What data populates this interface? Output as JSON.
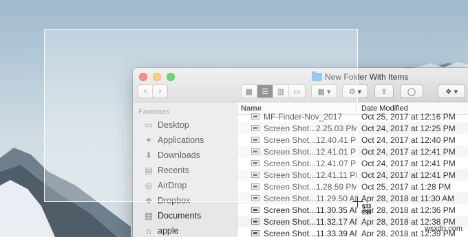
{
  "window": {
    "title": "New Folder With Items"
  },
  "toolbar": {
    "back_icon": "chevron-left-icon",
    "forward_icon": "chevron-right-icon",
    "views": [
      "icon-view-icon",
      "list-view-icon",
      "column-view-icon",
      "gallery-view-icon"
    ],
    "active_view": "list-view-icon"
  },
  "sidebar": {
    "heading": "Favorites",
    "items": [
      {
        "label": "Desktop",
        "icon": "desktop-icon"
      },
      {
        "label": "Applications",
        "icon": "applications-icon"
      },
      {
        "label": "Downloads",
        "icon": "downloads-icon"
      },
      {
        "label": "Recents",
        "icon": "recents-icon"
      },
      {
        "label": "AirDrop",
        "icon": "airdrop-icon"
      },
      {
        "label": "Dropbox",
        "icon": "dropbox-icon"
      },
      {
        "label": "Documents",
        "icon": "documents-icon"
      },
      {
        "label": "apple",
        "icon": "home-icon"
      }
    ]
  },
  "list": {
    "col_name": "Name",
    "col_date": "Date Modified",
    "rows": [
      {
        "name": "MF-Finder-Nov_2017",
        "date": "Oct 25, 2017 at 12:16 PM"
      },
      {
        "name": "Screen Shot...2.25.03 PM",
        "date": "Oct 24, 2017 at 12:25 PM"
      },
      {
        "name": "Screen Shot...12.40.41 PM",
        "date": "Oct 24, 2017 at 12:40 PM"
      },
      {
        "name": "Screen Shot...12.41.01 PM",
        "date": "Oct 24, 2017 at 12:41 PM"
      },
      {
        "name": "Screen Shot...12.41.07 PM",
        "date": "Oct 24, 2017 at 12:41 PM"
      },
      {
        "name": "Screen Shot...12.41.11 PM",
        "date": "Oct 24, 2017 at 12:41 PM"
      },
      {
        "name": "Screen Shot...1.28.59 PM",
        "date": "Oct 25, 2017 at 1:28 PM"
      },
      {
        "name": "Screen Shot...11.29.50 AM",
        "date": "Apr 28, 2018 at 11:30 AM"
      },
      {
        "name": "Screen Shot...11.30.35 AM",
        "date": "Apr 28, 2018 at 12:36 PM"
      },
      {
        "name": "Screen Shot...11.32.17 AM",
        "date": "Apr 28, 2018 at 12:38 PM"
      },
      {
        "name": "Screen Shot...11.33.39 AM",
        "date": "Apr 28, 2018 at 12:39 PM"
      }
    ]
  },
  "cursor": {
    "x_readout": "633",
    "y_readout": "295"
  },
  "watermark": "wsxdn.com"
}
